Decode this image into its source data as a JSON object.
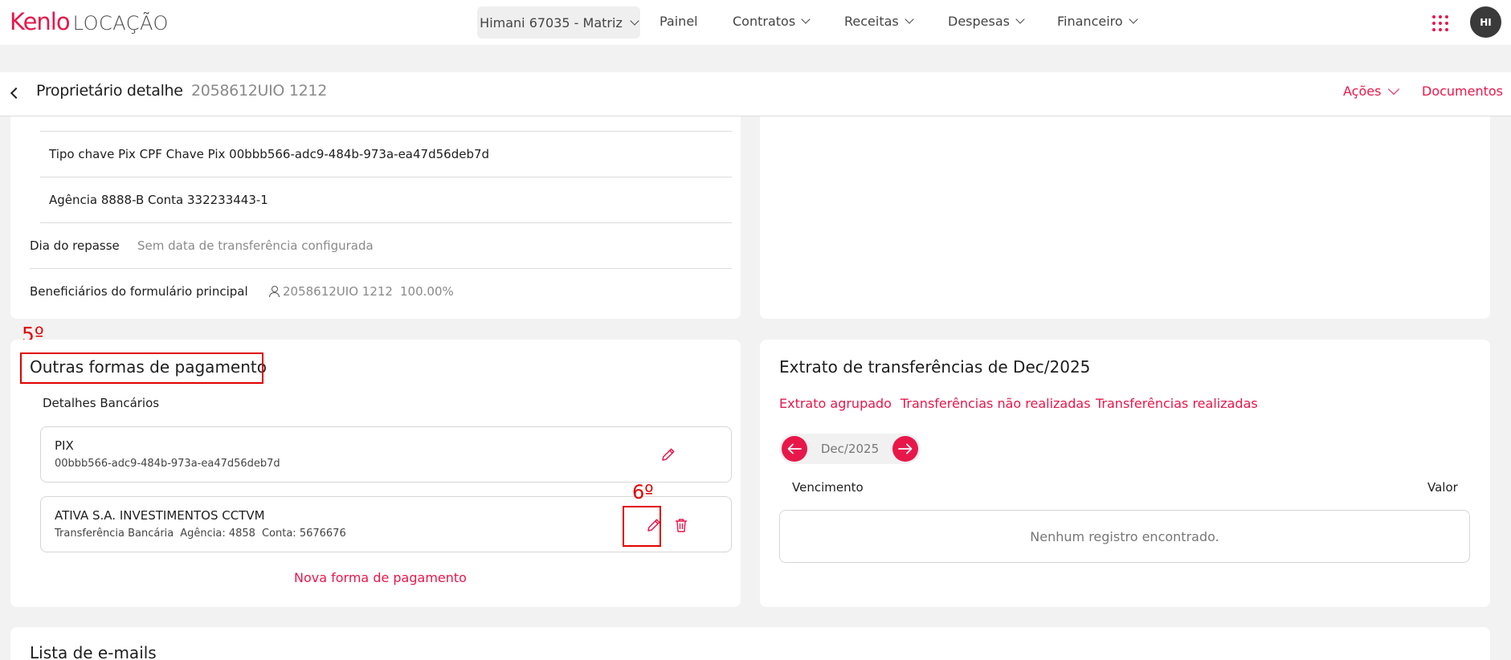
{
  "app": {
    "brand": "Kenlo",
    "product": "LOCAÇÃO",
    "accent": "#e8174a"
  },
  "topnav": {
    "branch": "Himani 67035 - Matriz",
    "items": [
      "Painel",
      "Contratos",
      "Receitas",
      "Despesas",
      "Financeiro"
    ],
    "apps_icon": "grid-dots-icon",
    "avatar": "HI"
  },
  "header": {
    "title": "Proprietário detalhe",
    "id": "2058612UIO 1212",
    "actions_label": "Ações",
    "documents_label": "Documentos"
  },
  "details": {
    "pix_row": "Tipo chave Pix CPF Chave Pix 00bbb566-adc9-484b-973a-ea47d56deb7d",
    "bank_row": "Agência 8888-B Conta 332233443-1",
    "repasse_label": "Dia do repasse",
    "repasse_value": "Sem data de transferência configurada",
    "beneficiaries_label": "Beneficiários do formulário principal",
    "beneficiary_name": "2058612UIO 1212",
    "beneficiary_pct": "100.00%"
  },
  "payments": {
    "annotation": "5º",
    "title": "Outras formas de pagamento",
    "subtitle": "Detalhes Bancários",
    "items": [
      {
        "title": "PIX",
        "sub": [
          "00bbb566-adc9-484b-973a-ea47d56deb7d"
        ]
      },
      {
        "title": "ATIVA S.A. INVESTIMENTOS CCTVM",
        "sub": [
          "Transferência Bancária",
          "Agência: 4858",
          "Conta: 5676676"
        ]
      }
    ],
    "edit_annotation": "6º",
    "new_label": "Nova forma de pagamento"
  },
  "statement": {
    "title": "Extrato de transferências de Dec/2025",
    "tabs": [
      "Extrato agrupado",
      "Transferências não realizadas",
      "Transferências realizadas"
    ],
    "month": "Dec/2025",
    "col_due": "Vencimento",
    "col_value": "Valor",
    "empty": "Nenhum registro encontrado."
  },
  "emails": {
    "title": "Lista de e-mails"
  },
  "annotation_color": "#e00000"
}
